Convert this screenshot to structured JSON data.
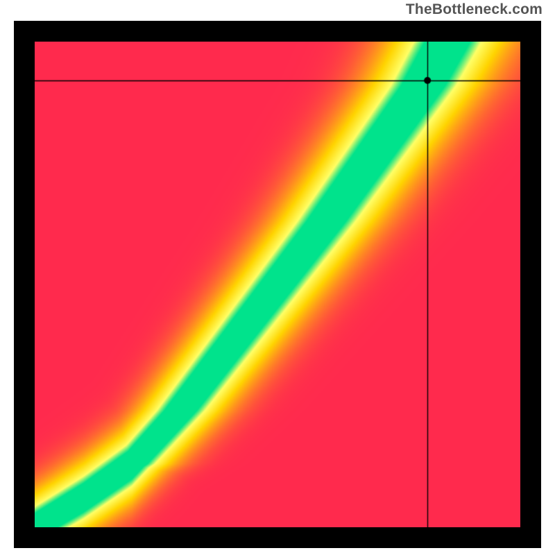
{
  "watermark": {
    "text": "TheBottleneck.com"
  },
  "chart_data": {
    "type": "heatmap",
    "title": "",
    "xlabel": "",
    "ylabel": "",
    "x_range": [
      0,
      100
    ],
    "y_range": [
      0,
      100
    ],
    "grid": false,
    "legend": false,
    "color_scale": {
      "description": "green = well matched, yellow = moderate bottleneck, red = severe bottleneck",
      "stops": [
        {
          "pos": 0.0,
          "color": "#ff2a4d"
        },
        {
          "pos": 0.5,
          "color": "#ffd400"
        },
        {
          "pos": 0.75,
          "color": "#ffff66"
        },
        {
          "pos": 0.88,
          "color": "#00e38c"
        },
        {
          "pos": 1.0,
          "color": "#00e38c"
        }
      ]
    },
    "optimal_curve": [
      {
        "x": 0,
        "y": 0
      },
      {
        "x": 10,
        "y": 6
      },
      {
        "x": 20,
        "y": 13
      },
      {
        "x": 30,
        "y": 24
      },
      {
        "x": 40,
        "y": 37
      },
      {
        "x": 50,
        "y": 50
      },
      {
        "x": 60,
        "y": 63
      },
      {
        "x": 70,
        "y": 77
      },
      {
        "x": 80,
        "y": 91
      },
      {
        "x": 85,
        "y": 100
      }
    ],
    "marker": {
      "x": 81,
      "y": 92
    },
    "crosshair_lines": true
  }
}
